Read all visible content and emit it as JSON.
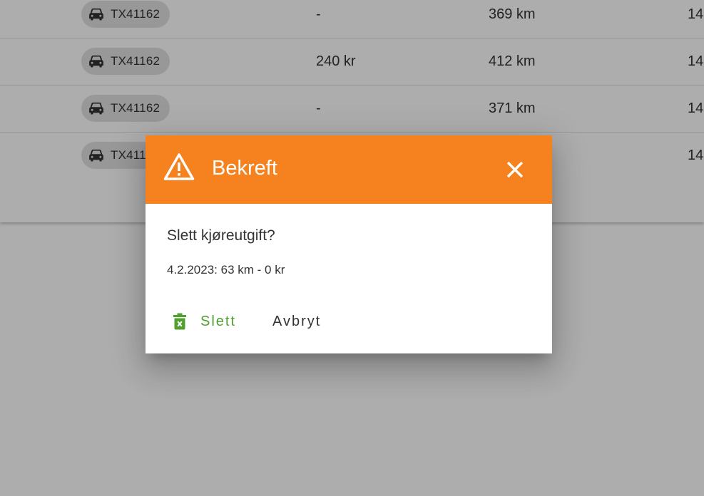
{
  "table": {
    "rows": [
      {
        "vehicle": "TX41162",
        "amount": "-",
        "distance": "369 km",
        "extra": "14"
      },
      {
        "vehicle": "TX41162",
        "amount": "240 kr",
        "distance": "412 km",
        "extra": "14"
      },
      {
        "vehicle": "TX41162",
        "amount": "-",
        "distance": "371 km",
        "extra": "14"
      },
      {
        "vehicle": "TX41162",
        "amount": "",
        "distance": "",
        "extra": "14"
      }
    ],
    "vehicle_icon": "car-icon"
  },
  "dialog": {
    "title": "Bekreft",
    "header_icon": "warning-icon",
    "close_icon": "close-icon",
    "question": "Slett kjøreutgift?",
    "detail": "4.2.2023: 63 km - 0 kr",
    "delete_label": "Slett",
    "delete_icon": "trash-icon",
    "cancel_label": "Avbryt"
  },
  "colors": {
    "header": "#f5821f",
    "delete": "#4fa02f",
    "scrim": "rgba(0,0,0,0.32)"
  }
}
